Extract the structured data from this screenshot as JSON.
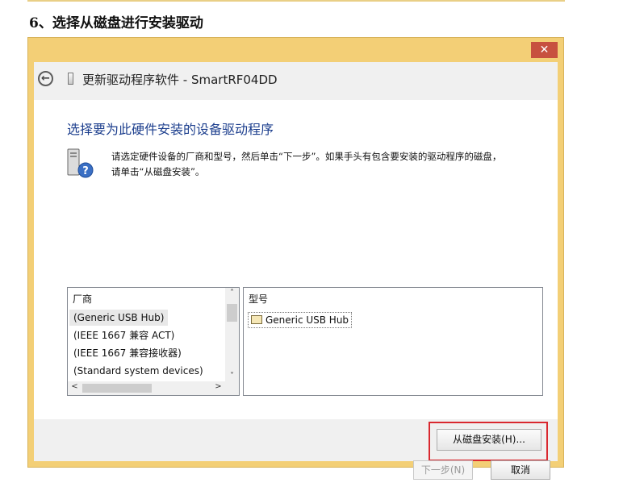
{
  "doc": {
    "heading": "6、选择从磁盘进行安装驱动"
  },
  "window": {
    "close_label": "✕",
    "back_icon": "←",
    "title": "更新驱动程序软件 - SmartRF04DD",
    "heading": "选择要为此硬件安装的设备驱动程序",
    "instruction_line1": "请选定硬件设备的厂商和型号，然后单击“下一步”。如果手头有包含要安装的驱动程序的磁盘，",
    "instruction_line2": "请单击“从磁盘安装”。",
    "manufacturer_list": {
      "header": "厂商",
      "items": [
        "(Generic USB Hub)",
        "(IEEE 1667 兼容 ACT)",
        "(IEEE 1667 兼容接收器)",
        "(Standard system devices)"
      ],
      "selected_index": 0
    },
    "model_list": {
      "header": "型号",
      "items": [
        "Generic USB Hub"
      ]
    },
    "scroll_up": "˄",
    "scroll_down": "˅",
    "scroll_left": "<",
    "scroll_right": ">",
    "buttons": {
      "have_disk": "从磁盘安装(H)...",
      "next": "下一步(N)",
      "cancel": "取消"
    }
  }
}
